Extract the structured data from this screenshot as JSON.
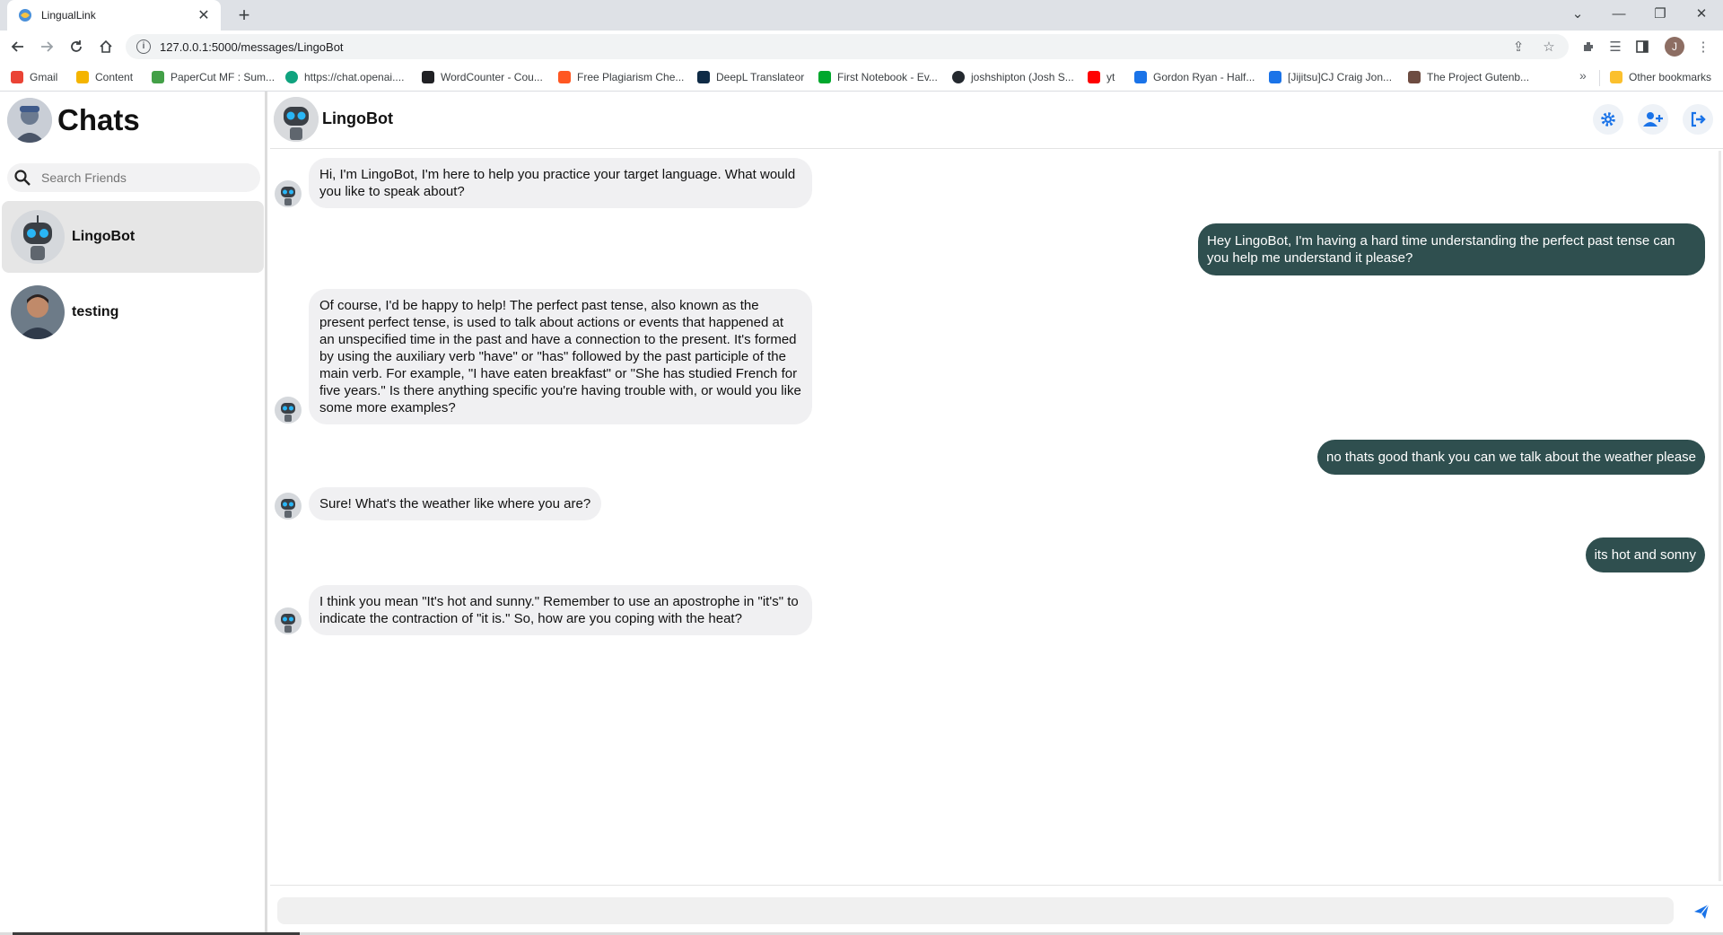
{
  "browser": {
    "tab_title": "LingualLink",
    "url": "127.0.0.1:5000/messages/LingoBot",
    "profile_initial": "J",
    "new_tab": "+",
    "bookmarks": [
      {
        "label": "Gmail",
        "color": "#ea4335"
      },
      {
        "label": "Content",
        "color": "#f4b400"
      },
      {
        "label": "PaperCut MF : Sum...",
        "color": "#43a047"
      },
      {
        "label": "https://chat.openai....",
        "color": "#10a37f"
      },
      {
        "label": "WordCounter - Cou...",
        "color": "#202124"
      },
      {
        "label": "Free Plagiarism Che...",
        "color": "#ff5722"
      },
      {
        "label": "DeepL Translateor",
        "color": "#0f2b46"
      },
      {
        "label": "First Notebook - Ev...",
        "color": "#00a82d"
      },
      {
        "label": "joshshipton (Josh S...",
        "color": "#24292f"
      },
      {
        "label": "yt",
        "color": "#ff0000"
      },
      {
        "label": "Gordon Ryan - Half...",
        "color": "#1a73e8"
      },
      {
        "label": "[Jijitsu]CJ Craig Jon...",
        "color": "#1a73e8"
      },
      {
        "label": "The Project Gutenb...",
        "color": "#6d4c41"
      }
    ],
    "more_bookmarks": "»",
    "other_bookmarks": "Other bookmarks"
  },
  "sidebar": {
    "title": "Chats",
    "search_placeholder": "Search Friends",
    "contacts": [
      {
        "name": "LingoBot",
        "active": true
      },
      {
        "name": "testing",
        "active": false
      }
    ]
  },
  "chat": {
    "contact_name": "LingoBot",
    "accent_color": "#1a73e8",
    "user_bubble_color": "#2f4f4f",
    "messages": [
      {
        "from": "bot",
        "text": "Hi, I'm LingoBot, I'm here to help you practice your target language. What would you like to speak about?"
      },
      {
        "from": "user",
        "text": "Hey LingoBot, I'm having a hard time understanding the perfect past tense can you help me understand it please?"
      },
      {
        "from": "bot",
        "text": "Of course, I'd be happy to help! The perfect past tense, also known as the present perfect tense, is used to talk about actions or events that happened at an unspecified time in the past and have a connection to the present. It's formed by using the auxiliary verb \"have\" or \"has\" followed by the past participle of the main verb. For example, \"I have eaten breakfast\" or \"She has studied French for five years.\" Is there anything specific you're having trouble with, or would you like some more examples?"
      },
      {
        "from": "user",
        "text": "no thats good thank you can we talk about the weather please"
      },
      {
        "from": "bot",
        "text": "Sure! What's the weather like where you are?"
      },
      {
        "from": "user",
        "text": "its hot and sonny"
      },
      {
        "from": "bot",
        "text": "I think you mean \"It's hot and sunny.\" Remember to use an apostrophe in \"it's\" to indicate the contraction of \"it is.\" So, how are you coping with the heat?"
      }
    ],
    "composer_value": ""
  }
}
